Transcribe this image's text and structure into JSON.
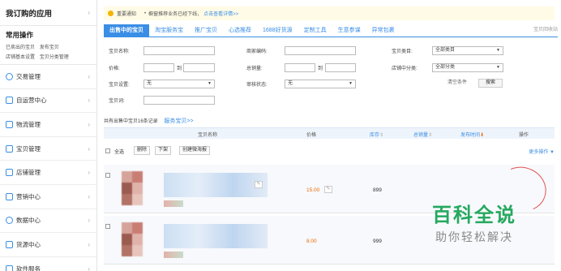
{
  "sidebar": {
    "my_apps": "我订购的应用",
    "common_ops": {
      "title": "常用操作",
      "links_row1": [
        "已卖出的宝贝",
        "发布宝贝"
      ],
      "links_row2": [
        "店铺基本设置",
        "宝贝分类管理"
      ]
    },
    "items": [
      {
        "label": "交易管理",
        "icon": "transaction-icon"
      },
      {
        "label": "自运营中心",
        "icon": "chat-bubble-icon"
      },
      {
        "label": "物流管理",
        "icon": "logistics-icon"
      },
      {
        "label": "宝贝管理",
        "icon": "shopping-bag-icon"
      },
      {
        "label": "店铺管理",
        "icon": "store-icon"
      },
      {
        "label": "营销中心",
        "icon": "megaphone-icon"
      },
      {
        "label": "数据中心",
        "icon": "dashboard-icon"
      },
      {
        "label": "货源中心",
        "icon": "supply-icon"
      },
      {
        "label": "软件服务",
        "icon": "software-icon"
      }
    ]
  },
  "notice": {
    "label": "重要通知",
    "text": "橱窗推荐业务已经下线，",
    "link": "点击查看详情>>"
  },
  "tabs": [
    "出售中的宝贝",
    "淘宝服务宝",
    "推广宝贝",
    "心选推荐",
    "1688好货源",
    "定制工具",
    "生意参谋",
    "异常包裹"
  ],
  "tab_right": "宝贝回收站",
  "form": {
    "item_name": "宝贝名称:",
    "merchant_code": "商家编码:",
    "category": "宝贝类目:",
    "category_value": "全部类目",
    "price": "价格:",
    "to1": "到",
    "total_sales": "总销量:",
    "to2": "到",
    "store_category": "店铺中分类:",
    "store_category_value": "全部分类",
    "item_settings": "宝贝设置:",
    "item_settings_value": "无",
    "violation_status": "审核状态:",
    "violation_value": "无",
    "clear_btn": "清空条件",
    "search_btn": "搜索",
    "keyword": "宝贝词:"
  },
  "summary": {
    "text": "共有出售中宝贝16条记录",
    "link": "服务宝贝>>"
  },
  "table": {
    "headers": {
      "name": "宝贝名称",
      "price": "价格",
      "stock": "库存",
      "sales": "总销量",
      "publish_time": "发布时间",
      "actions": "操作"
    },
    "toolbar": {
      "select_all": "全选",
      "delete": "删除",
      "offshelf": "下架",
      "create_poster": "创建微海报",
      "more": "更多操作 ▼"
    },
    "rows": [
      {
        "price": "15.00",
        "stock": "899"
      },
      {
        "price": "8.00",
        "stock": "999"
      }
    ]
  },
  "watermark": {
    "title": "百科全说",
    "subtitle": "助你轻松解决"
  },
  "colors": {
    "accent": "#3a8ee6",
    "price": "#f06a00",
    "notice_bg": "#fffbe6",
    "watermark": "#25a85f"
  }
}
